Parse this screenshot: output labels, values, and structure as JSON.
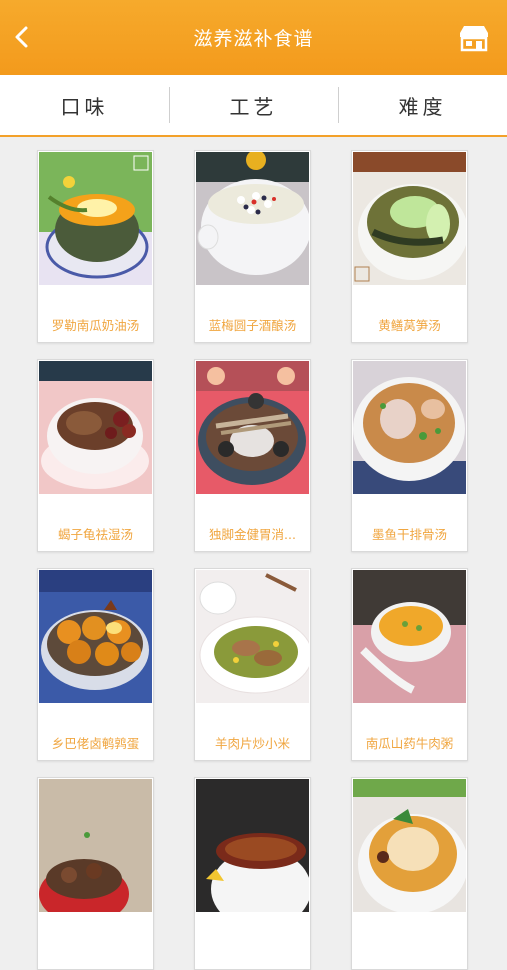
{
  "header": {
    "title": "滋养滋补食谱",
    "back_icon": "chevron-left-icon",
    "shop_icon": "storefront-icon"
  },
  "tabs": [
    {
      "label": "口味"
    },
    {
      "label": "工艺"
    },
    {
      "label": "难度"
    }
  ],
  "colors": {
    "accent": "#f39a1c",
    "card_title": "#f0a640",
    "background": "#efefef"
  },
  "recipes": [
    {
      "name": "罗勒南瓜奶油汤"
    },
    {
      "name": "蓝梅圆子酒酿汤"
    },
    {
      "name": "黄鳝莴笋汤"
    },
    {
      "name": "蝎子龟祛湿汤"
    },
    {
      "name": "独脚金健胃消..."
    },
    {
      "name": "墨鱼干排骨汤"
    },
    {
      "name": "乡巴佬卤鹌鹑蛋"
    },
    {
      "name": "羊肉片炒小米"
    },
    {
      "name": "南瓜山药牛肉粥"
    },
    {
      "name": ""
    },
    {
      "name": ""
    },
    {
      "name": ""
    }
  ]
}
